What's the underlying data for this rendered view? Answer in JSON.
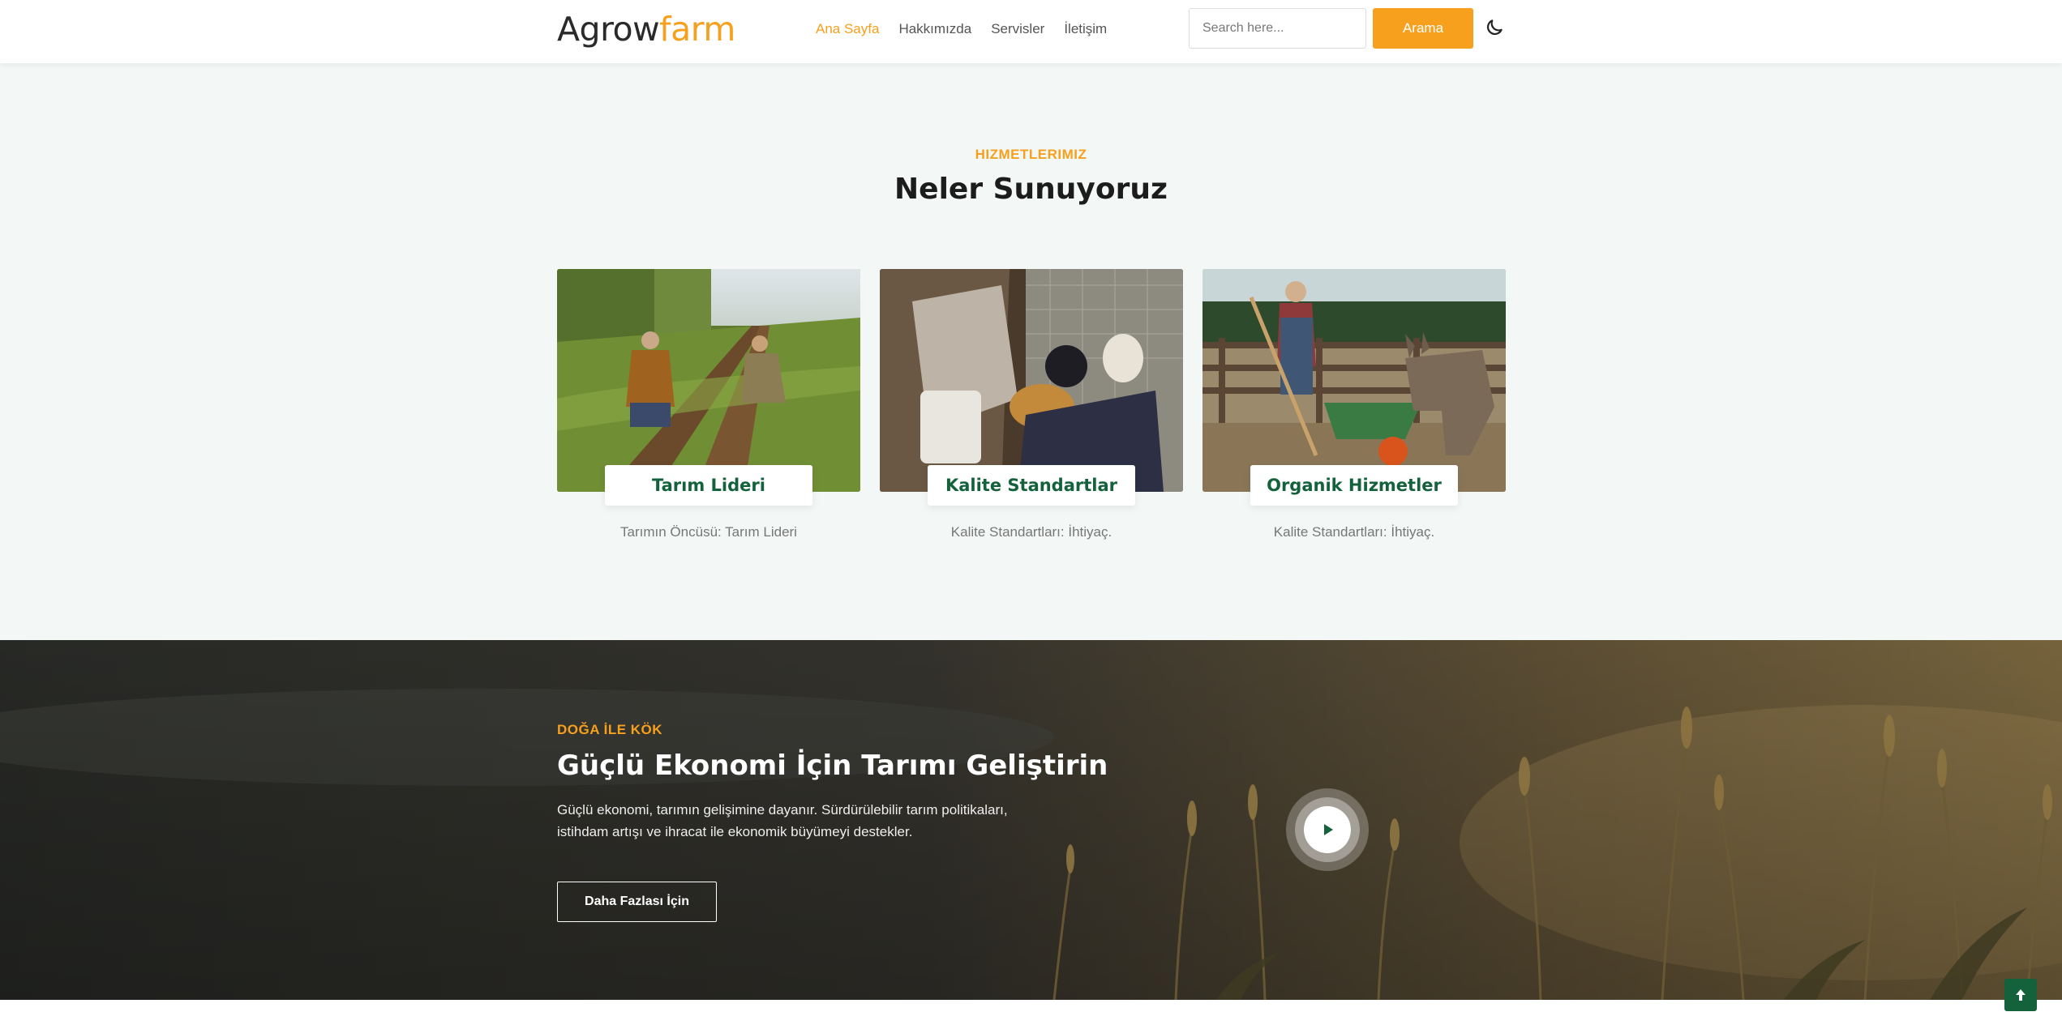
{
  "header": {
    "logo_part1": "Agrow",
    "logo_part2": "farm",
    "nav": [
      {
        "label": "Ana Sayfa",
        "active": true
      },
      {
        "label": "Hakkımızda"
      },
      {
        "label": "Servisler"
      },
      {
        "label": "İletişim"
      }
    ],
    "search": {
      "placeholder": "Search here...",
      "value": ""
    },
    "search_button": "Arama",
    "theme_toggle_icon": "moon-icon"
  },
  "services": {
    "eyebrow": "HIZMETLERIMIZ",
    "title": "Neler Sunuyoruz",
    "cards": [
      {
        "title": "Tarım Lideri",
        "description": "Tarımın Öncüsü: Tarım Lideri"
      },
      {
        "title": "Kalite Standartlar",
        "description": "Kalite Standartları: İhtiyaç."
      },
      {
        "title": "Organik Hizmetler",
        "description": "Kalite Standartları: İhtiyaç."
      }
    ]
  },
  "hero": {
    "eyebrow": "DOĞA İLE KÖK",
    "title": "Güçlü Ekonomi İçin Tarımı Geliştirin",
    "text": "Güçlü ekonomi, tarımın gelişimine dayanır. Sürdürülebilir tarım politikaları, istihdam artışı ve ihracat ile ekonomik büyümeyi destekler.",
    "button": "Daha Fazlası İçin",
    "play_icon": "play-icon"
  },
  "scroll_top_icon": "arrow-up-icon",
  "colors": {
    "accent": "#f6a01d",
    "brand_green": "#14623b",
    "section_bg": "#f3f7f5"
  }
}
